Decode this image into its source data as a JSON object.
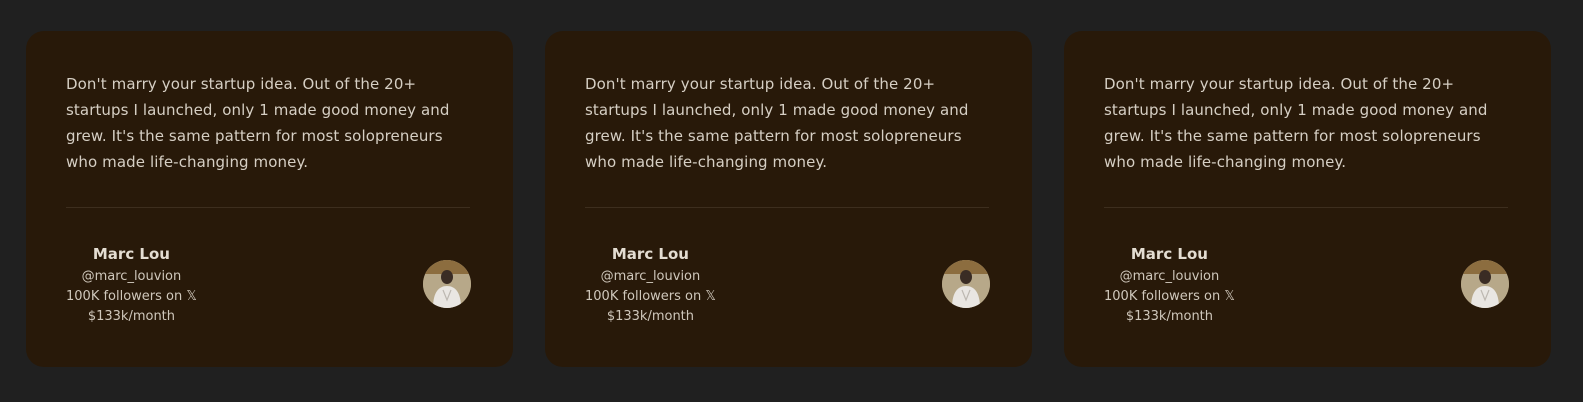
{
  "testimonials": [
    {
      "quote": "Don't marry your startup idea. Out of the 20+ startups I launched, only 1 made good money and grew. It's the same pattern for most solopreneurs who made life-changing money.",
      "name": "Marc Lou",
      "handle": "@marc_louvion",
      "followers": "100K followers on 𝕏",
      "revenue": "$133k/month",
      "avatar_icon": "person-avatar-icon"
    },
    {
      "quote": "Don't marry your startup idea. Out of the 20+ startups I launched, only 1 made good money and grew. It's the same pattern for most solopreneurs who made life-changing money.",
      "name": "Marc Lou",
      "handle": "@marc_louvion",
      "followers": "100K followers on 𝕏",
      "revenue": "$133k/month",
      "avatar_icon": "person-avatar-icon"
    },
    {
      "quote": "Don't marry your startup idea. Out of the 20+ startups I launched, only 1 made good money and grew. It's the same pattern for most solopreneurs who made life-changing money.",
      "name": "Marc Lou",
      "handle": "@marc_louvion",
      "followers": "100K followers on 𝕏",
      "revenue": "$133k/month",
      "avatar_icon": "person-avatar-icon"
    }
  ],
  "colors": {
    "background": "#202020",
    "card": "#281909",
    "text": "#d6cfc4"
  }
}
